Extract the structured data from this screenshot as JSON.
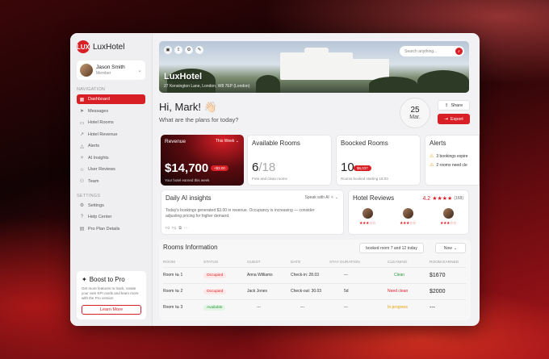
{
  "app": {
    "logo_mark": "LUX",
    "name": "LuxHotel"
  },
  "user": {
    "name": "Jason Smith",
    "role": "Member"
  },
  "nav_section": "NAVIGATION",
  "nav": [
    {
      "label": "Dashboard",
      "icon": "grid-icon"
    },
    {
      "label": "Messages",
      "icon": "send-icon"
    },
    {
      "label": "Hotel Rooms",
      "icon": "bed-icon"
    },
    {
      "label": "Hotel Revenue",
      "icon": "chart-icon"
    },
    {
      "label": "Alerts",
      "icon": "warning-icon"
    },
    {
      "label": "AI Insights",
      "icon": "sparkle-icon"
    },
    {
      "label": "User Reviews",
      "icon": "star-icon"
    },
    {
      "label": "Team",
      "icon": "team-icon"
    }
  ],
  "settings_section": "SETTINGS",
  "settings_nav": [
    {
      "label": "Settings",
      "icon": "gear-icon"
    },
    {
      "label": "Help Center",
      "icon": "help-icon"
    },
    {
      "label": "Pro Plan Details",
      "icon": "card-icon"
    }
  ],
  "promo": {
    "title": "Boost to Pro",
    "text": "Get more features to track, create your own KPI cards and learn more with the Pro version",
    "button": "Learn More"
  },
  "hero": {
    "title": "LuxHotel",
    "address": "27 Kensington Lane, London, W8 7EP (London)",
    "search_placeholder": "Search anything..."
  },
  "greeting": "Hi, Mark! 👋🏻",
  "subgreeting": "What are the plans for today?",
  "date": {
    "day": "25",
    "month": "Mar."
  },
  "actions": {
    "share": "Share",
    "export": "Export"
  },
  "revenue": {
    "title": "Revenue",
    "period": "This Week",
    "value": "$14,700",
    "badge": "+$3.00",
    "subtitle": "Your hotel earned this week"
  },
  "available": {
    "title": "Available Rooms",
    "value": "6",
    "total": "/18",
    "subtitle": "Free and clean rooms"
  },
  "booked": {
    "title": "Boocked Rooms",
    "value": "10",
    "badge": "$6,037",
    "subtitle": "Rooms booked starting 18.03"
  },
  "alerts": {
    "title": "Alerts",
    "items": [
      "3 bookings expire",
      "2 rooms need cle"
    ]
  },
  "ai": {
    "title": "Daily AI insights",
    "speak": "Speak with AI",
    "text": "Today's bookings generated $3.00 in revenue. Occupancy is increasing — consider adjusting pricing for higher demand."
  },
  "reviews": {
    "title": "Hotel Reviews",
    "rating": "4.2",
    "count": "(168)",
    "items": [
      {
        "stars": "★★★☆☆"
      },
      {
        "stars": "★★★☆☆"
      },
      {
        "stars": "★★★☆☆"
      }
    ]
  },
  "rooms": {
    "title": "Rooms Information",
    "chip": "booked room 7 and 12 today",
    "filter": "Now",
    "columns": [
      "ROOM",
      "STATUS",
      "GUEST",
      "DATE",
      "STAY DURATION",
      "CLEANING",
      "ROOM EARNED"
    ],
    "rows": [
      {
        "room": "Room № 1",
        "status": "Occupied",
        "guest": "Anna Williams",
        "date": "Check-in: 28.03",
        "stay": "---",
        "cleaning": "Clean",
        "earned": "$1670"
      },
      {
        "room": "Room № 2",
        "status": "Occupied",
        "guest": "Jack Jones",
        "date": "Check-out: 30.03",
        "stay": "5d",
        "cleaning": "Need clean",
        "earned": "$2000"
      },
      {
        "room": "Room № 3",
        "status": "Available",
        "guest": "---",
        "date": "---",
        "stay": "---",
        "cleaning": "In progress",
        "earned": "---"
      }
    ]
  },
  "colors": {
    "accent": "#d81f26",
    "available": "#2b9a3c",
    "warning": "#e5a000"
  }
}
